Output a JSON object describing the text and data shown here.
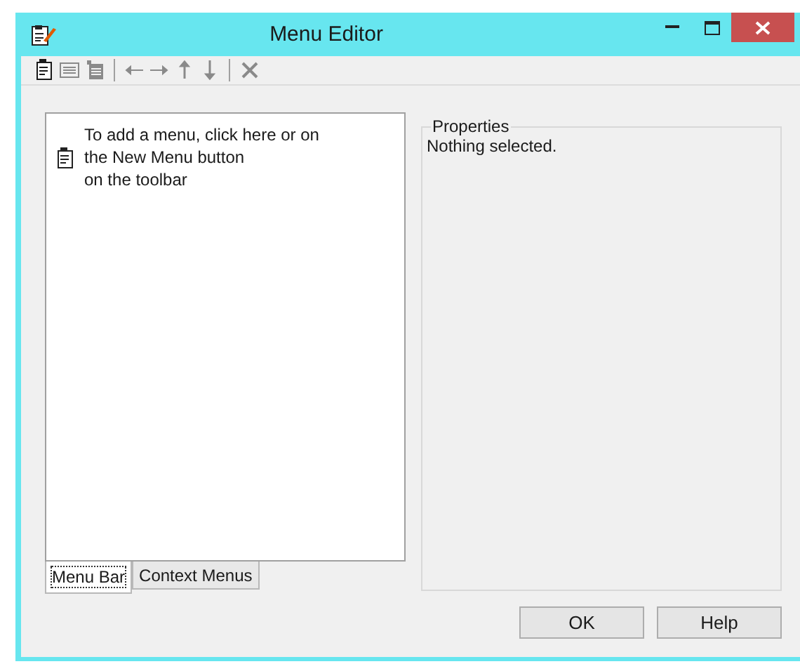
{
  "window": {
    "title": "Menu Editor"
  },
  "toolbar": [
    {
      "kind": "new-menu",
      "disabled": false
    },
    {
      "kind": "new-item",
      "disabled": true
    },
    {
      "kind": "new-submenu",
      "disabled": true
    },
    {
      "kind": "separator"
    },
    {
      "kind": "left",
      "disabled": true
    },
    {
      "kind": "right",
      "disabled": true
    },
    {
      "kind": "up",
      "disabled": true
    },
    {
      "kind": "down",
      "disabled": true
    },
    {
      "kind": "separator"
    },
    {
      "kind": "delete",
      "disabled": true
    }
  ],
  "tree": {
    "hint": "To add a menu, click here or on\nthe New Menu button\non the toolbar"
  },
  "tabs": [
    {
      "label": "Menu Bar",
      "selected": true
    },
    {
      "label": "Context Menus",
      "selected": false
    }
  ],
  "properties": {
    "title": "Properties",
    "text": "Nothing selected."
  },
  "buttons": [
    "OK",
    "Help"
  ]
}
